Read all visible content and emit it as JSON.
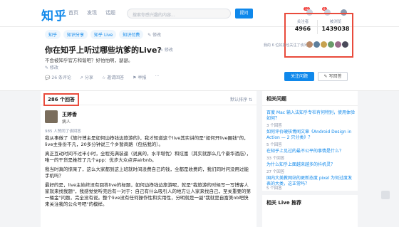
{
  "nav": {
    "logo": "知乎",
    "links": [
      "首页",
      "发现",
      "话题"
    ],
    "search_placeholder": "搜索你感兴趣的内容...",
    "ask_button": "提问",
    "badges": [
      "12",
      "8"
    ]
  },
  "question": {
    "topics": [
      "知乎",
      "知识分享",
      "知乎 Live",
      "知识付费"
    ],
    "topic_edit": "✎ 修改",
    "title": "你在知乎上听过哪些坑爹的Live?",
    "title_edit": "✎ 修改",
    "description": "不会被知乎官方和谐吧？好怕怕啊，瑟瑟。",
    "desc_edit": "✎ 修改",
    "actions": [
      "💬 26 条评论",
      "↗ 分享",
      "☆ 邀请回答",
      "⚑ 举报",
      "···"
    ],
    "follow_button": "关注问题",
    "write_button": "✎ 写回答"
  },
  "stats": {
    "followers_label": "关注者",
    "followers_value": "4966",
    "views_label": "被浏览",
    "views_value": "1439038",
    "friends_label": "我的 6 位好友也关注了该问题"
  },
  "answers": {
    "count_label": "286 个回答",
    "sort_label": "默认排序 ⇅",
    "author_name": "王婷香",
    "author_bio": "病人",
    "votes": "985 人赞同了该回答",
    "paragraphs": [
      "我从事做了《旅行博主是如何边挣钱边旅游的》，我才知道这个live其实讲的是\"如何开live圈钱\"的，live主身份不凡，20多分钟说三个乡暂商路（包括我的）。",
      "真正互动时间不过半小时，全程充满装逼（说真的，水平堪忧）和炫富（其实就那么几个豪华酒店），唯一的干货是推荐了几个app：优步大众点评airbnb。",
      "我当时真的惊呆了，这么大家都到这上班就时间浪费自己的钱，全都是收费的，我们同时问没用过能手机吗？",
      "最好的是，live主始终没有回答live的标题，如何边挣钱边旅游呢，就是\"我旅游的时候写一写博客人家就来找我题\"，我感觉觉听完后有一对于：自己有什么吸引人的地方让人家来找自己，至关重要的第一桶金\"问题，完全没有说。整个live没有任何操作性和实用性，分明就是一副\"我就是自富美nb吧快来关注我的公众号吧\"的模样。"
    ]
  },
  "side": {
    "title": "相关问题",
    "questions": [
      {
        "q": "百度 Mac 输入法知乎专栏有何特别，使用体验如何？",
        "count": "3 个回答"
      },
      {
        "q": "如何评价硬核博闻文章《Android Design in Action — 2 只分类》？",
        "count": "5 个回答"
      },
      {
        "q": "在知乎上见过的最不公平的事情是什么？",
        "count": "33 个回答"
      },
      {
        "q": "为什么知乎上面越来越多的抖机灵？",
        "count": "27 个回答"
      },
      {
        "q": "国内大美教网站的更新态度 pixel 为何过度发表的大类，这正常吗？",
        "count": "5 个回答"
      }
    ],
    "live_title": "相关 Live 推荐"
  },
  "colors": {
    "brand": "#0f88eb",
    "highlight_box": "#e94b3c"
  }
}
